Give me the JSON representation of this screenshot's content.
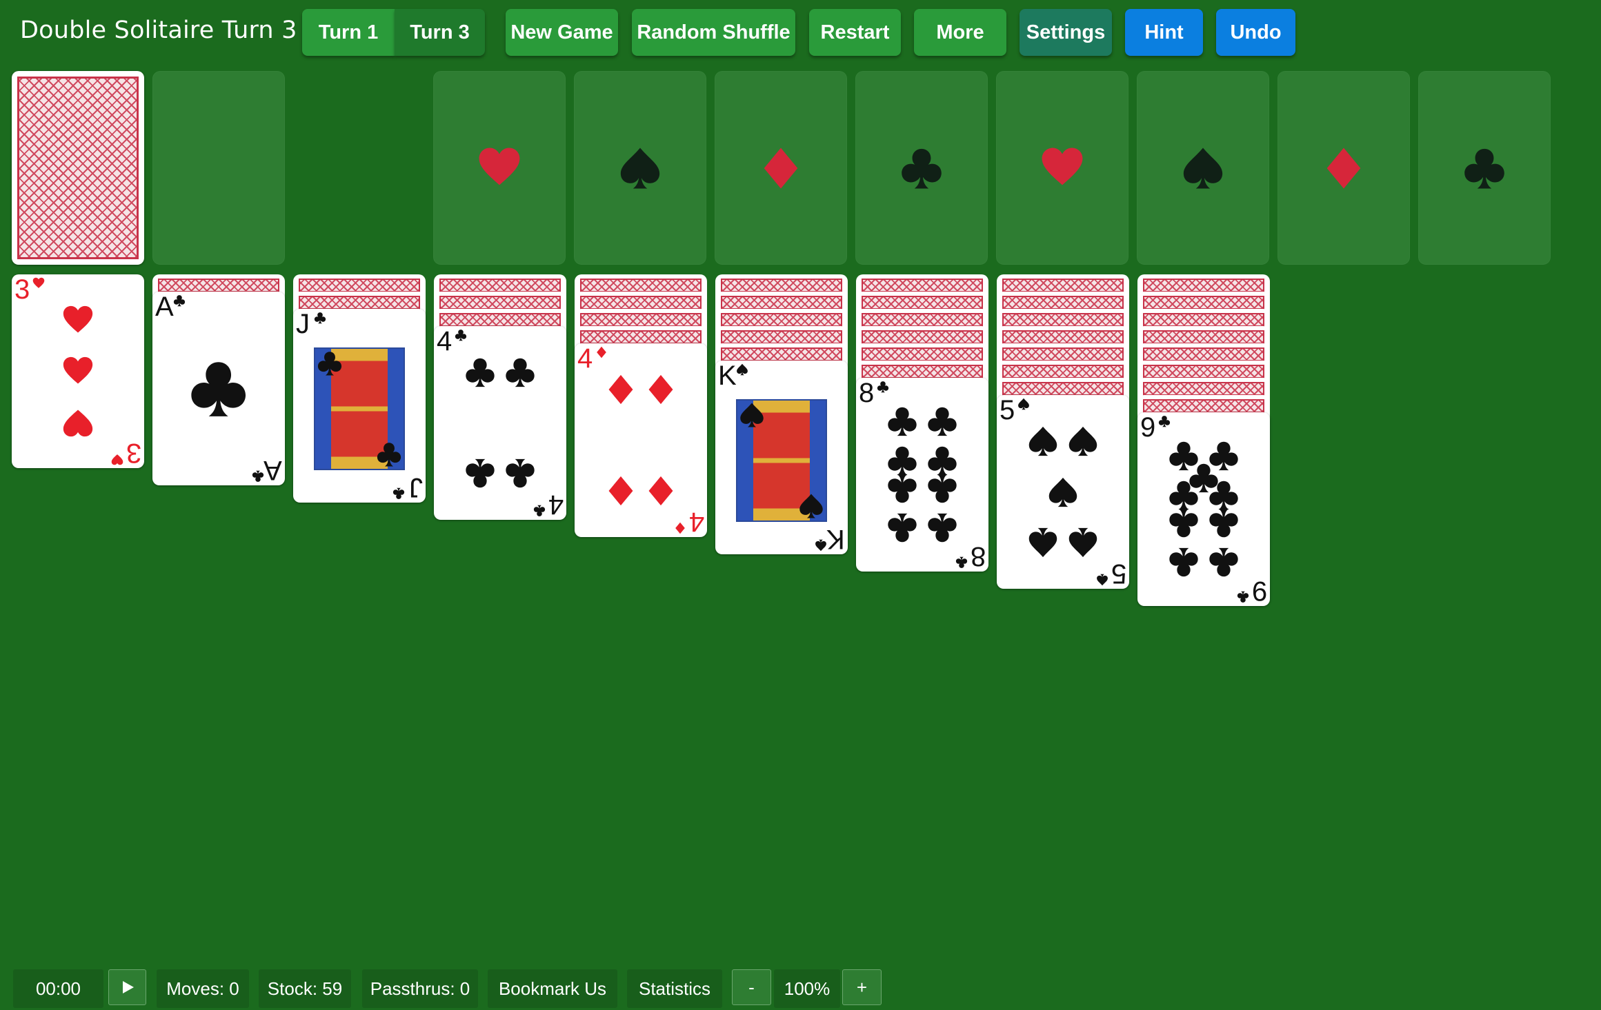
{
  "app": {
    "title": "Double Solitaire Turn 3"
  },
  "toolbar": {
    "turn1_label": "Turn 1",
    "turn3_label": "Turn 3",
    "new_game_label": "New Game",
    "random_shuffle_label": "Random Shuffle",
    "restart_label": "Restart",
    "more_label": "More",
    "settings_label": "Settings",
    "hint_label": "Hint",
    "undo_label": "Undo"
  },
  "foundations": [
    "heart",
    "spade",
    "diamond",
    "club",
    "heart",
    "spade",
    "diamond",
    "club"
  ],
  "tableau": [
    {
      "face_down": 0,
      "rank": "3",
      "suit": "heart"
    },
    {
      "face_down": 1,
      "rank": "A",
      "suit": "club"
    },
    {
      "face_down": 2,
      "rank": "J",
      "suit": "club"
    },
    {
      "face_down": 3,
      "rank": "4",
      "suit": "club"
    },
    {
      "face_down": 4,
      "rank": "4",
      "suit": "diamond"
    },
    {
      "face_down": 5,
      "rank": "K",
      "suit": "spade"
    },
    {
      "face_down": 6,
      "rank": "8",
      "suit": "club"
    },
    {
      "face_down": 7,
      "rank": "5",
      "suit": "spade"
    },
    {
      "face_down": 8,
      "rank": "9",
      "suit": "club"
    }
  ],
  "footer": {
    "timer": "00:00",
    "play_icon": "play-icon",
    "moves": "Moves: 0",
    "stock": "Stock: 59",
    "passthrus": "Passthrus: 0",
    "bookmark_label": "Bookmark Us",
    "statistics_label": "Statistics",
    "zoom_out_label": "-",
    "zoom": "100%",
    "zoom_in_label": "+"
  },
  "colors": {
    "felt": "#1b6b1e",
    "slot": "#2e7d32",
    "green_button": "#2a9b3a",
    "blue_button": "#0b7fe0",
    "red_suit": "#e8202a",
    "card_back": "#d04a5f"
  }
}
